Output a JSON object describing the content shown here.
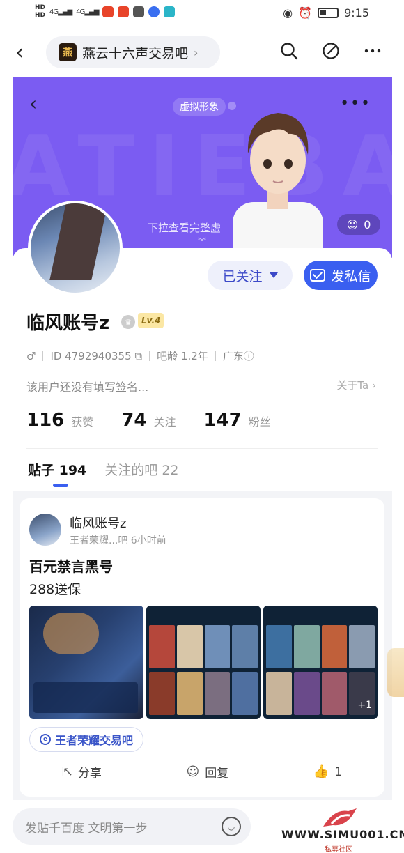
{
  "status_bar": {
    "hd1": "HD",
    "hd2": "HD",
    "net1": "4G",
    "net2": "4G",
    "time": "9:15"
  },
  "nav": {
    "forum_name": "燕云十六声交易吧",
    "forum_logo_text": "燕"
  },
  "banner": {
    "virtual_label": "虚拟形象",
    "pull_hint": "下拉查看完整虚",
    "like_count": "0",
    "bg_letters": "ATIEBA"
  },
  "profile": {
    "username": "临风账号z",
    "level": "Lv.4",
    "gender_icon": "♂",
    "user_id": "ID 4792940355",
    "age": "吧龄 1.2年",
    "region": "广东",
    "signature": "该用户还没有填写签名...",
    "about_link": "关于Ta",
    "follow_label": "已关注",
    "message_label": "发私信",
    "stats": [
      {
        "num": "116",
        "label": "获赞"
      },
      {
        "num": "74",
        "label": "关注"
      },
      {
        "num": "147",
        "label": "粉丝"
      }
    ],
    "tabs": {
      "posts": "贴子 194",
      "forums": "关注的吧 22"
    }
  },
  "post": {
    "author": "临风账号z",
    "sub": "王者荣耀...吧   6小时前",
    "title": "百元禁言黑号",
    "body": "288送保",
    "forum_chip": "王者荣耀交易吧",
    "plus_more": "+1",
    "actions": {
      "share": "分享",
      "reply": "回复",
      "like": "1"
    }
  },
  "bottom": {
    "compose_placeholder": "发贴千百度 文明第一步",
    "watermark_text": "WWW.SIMU001.CN",
    "watermark_sub": "私募社区"
  },
  "colors": {
    "banner": "#7b5cf2",
    "accent": "#3a5ff0",
    "level_badge": "#fbe7a4"
  }
}
